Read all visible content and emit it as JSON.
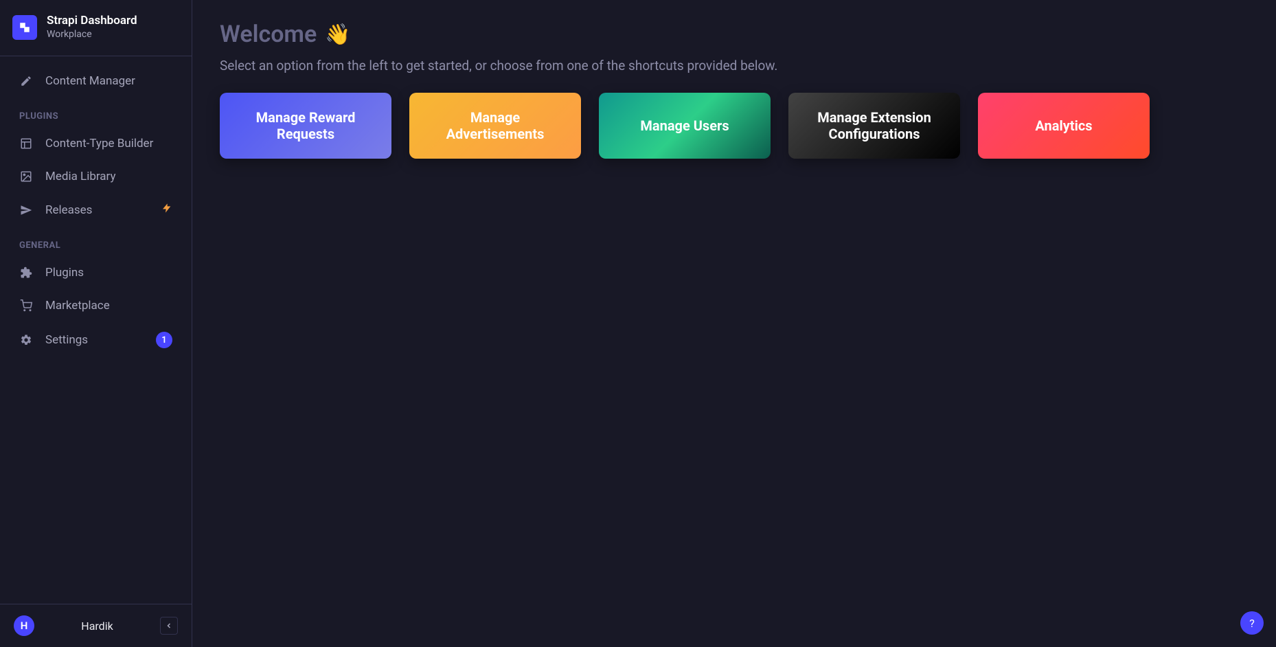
{
  "app": {
    "title": "Strapi Dashboard",
    "subtitle": "Workplace"
  },
  "sidebar": {
    "top_item": {
      "label": "Content Manager"
    },
    "section_plugins_label": "PLUGINS",
    "plugins": [
      {
        "label": "Content-Type Builder"
      },
      {
        "label": "Media Library"
      },
      {
        "label": "Releases"
      }
    ],
    "section_general_label": "GENERAL",
    "general": [
      {
        "label": "Plugins"
      },
      {
        "label": "Marketplace"
      },
      {
        "label": "Settings",
        "badge": "1"
      }
    ]
  },
  "user": {
    "initial": "H",
    "name": "Hardik"
  },
  "main": {
    "welcome_title": "Welcome",
    "wave_emoji": "👋",
    "welcome_sub": "Select an option from the left to get started, or choose from one of the shortcuts provided below.",
    "cards": [
      {
        "label": "Manage Reward Requests"
      },
      {
        "label": "Manage Advertisements"
      },
      {
        "label": "Manage Users"
      },
      {
        "label": "Manage Extension Configurations"
      },
      {
        "label": "Analytics"
      }
    ]
  },
  "help": {
    "label": "?"
  }
}
